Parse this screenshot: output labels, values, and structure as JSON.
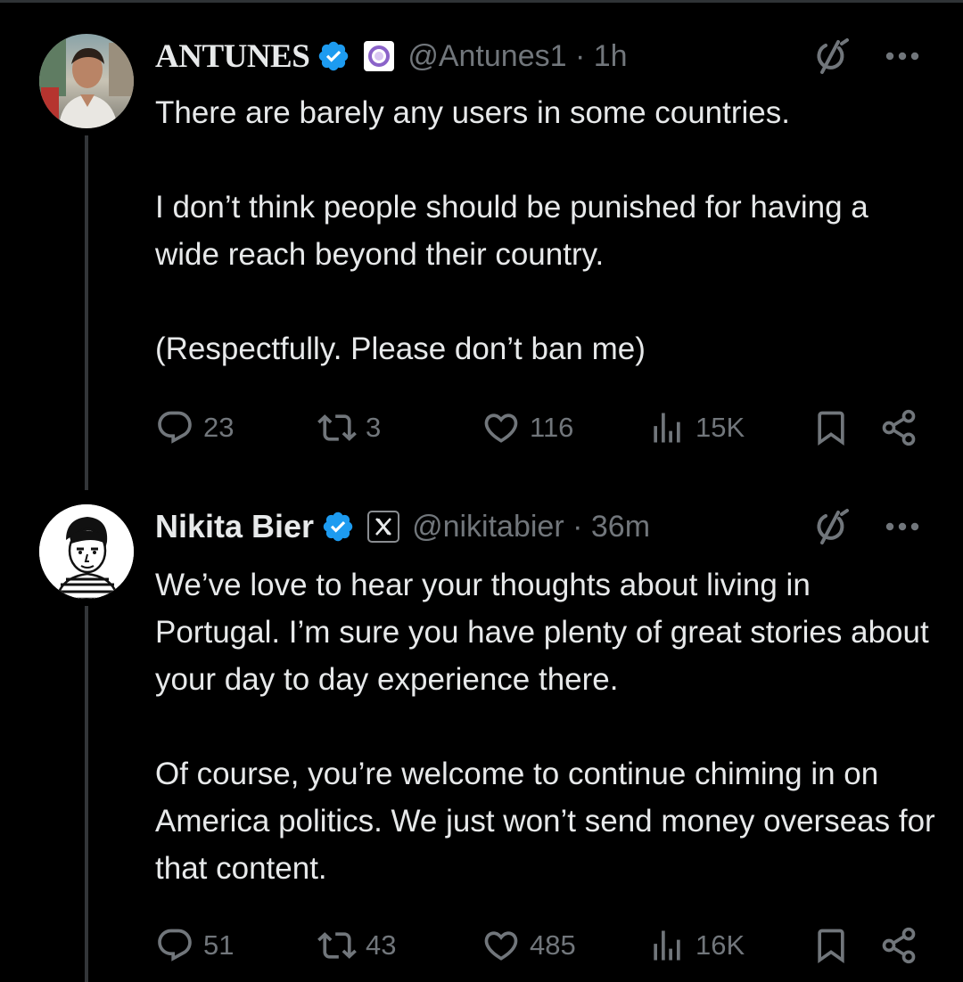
{
  "tweets": [
    {
      "display_name": "ANTUNES",
      "handle": "@Antunes1",
      "time": "1h",
      "verified": true,
      "affiliation_badge": "purple-ring-badge",
      "avatar": "profile-photo",
      "text": "There are barely any users in some countries.\n\nI don’t think people should be punished for having a wide reach beyond their country.\n\n(Respectfully. Please don’t ban me)",
      "stats": {
        "replies": "23",
        "reposts": "3",
        "likes": "116",
        "views": "15K"
      }
    },
    {
      "display_name": "Nikita Bier",
      "handle": "@nikitabier",
      "time": "36m",
      "verified": true,
      "affiliation_badge": "x-logo-badge",
      "avatar": "cartoon-portrait",
      "text": "We’ve love to hear your thoughts about living in Portugal. I’m sure you have plenty of great stories about your day to day experience there.\n\nOf course, you’re welcome to continue chiming in on America politics. We just won’t send money overseas for that content.",
      "stats": {
        "replies": "51",
        "reposts": "43",
        "likes": "485",
        "views": "16K"
      }
    }
  ],
  "colors": {
    "background": "#000000",
    "text": "#e7e9ea",
    "muted": "#71767b",
    "verified_blue": "#1d9bf0",
    "divider": "#2f3336"
  },
  "icons": {
    "header": [
      "grok-icon",
      "more-icon"
    ],
    "actions": [
      "reply-icon",
      "repost-icon",
      "like-icon",
      "views-icon",
      "bookmark-icon",
      "share-icon"
    ]
  }
}
